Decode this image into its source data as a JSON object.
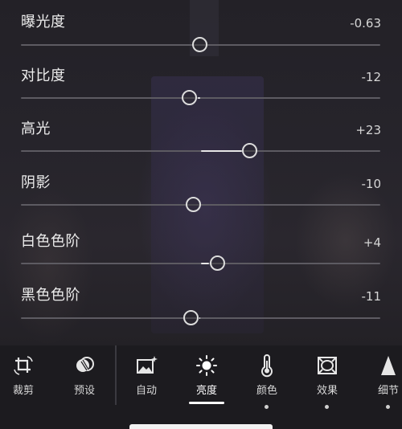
{
  "adjustments": [
    {
      "key": "exposure",
      "label": "曝光度",
      "value": "-0.63",
      "level": -0.06
    },
    {
      "key": "contrast",
      "label": "对比度",
      "value": "-12",
      "level": -0.12
    },
    {
      "key": "highlights",
      "label": "高光",
      "value": "+23",
      "level": 0.23
    },
    {
      "key": "shadows",
      "label": "阴影",
      "value": "-10",
      "level": -0.1
    },
    {
      "key": "whites",
      "label": "白色色阶",
      "value": "+4",
      "level": 0.04
    },
    {
      "key": "blacks",
      "label": "黑色色阶",
      "value": "-11",
      "level": -0.11
    }
  ],
  "toolbar": {
    "tools": [
      {
        "label": "裁剪",
        "icon": "crop-rotate-icon",
        "active": false,
        "dot": false
      },
      {
        "label": "预设",
        "icon": "presets-icon",
        "active": false,
        "dot": false
      },
      {
        "label": "自动",
        "icon": "auto-enhance-icon",
        "active": false,
        "dot": false
      },
      {
        "label": "亮度",
        "icon": "brightness-icon",
        "active": true,
        "dot": false
      },
      {
        "label": "颜色",
        "icon": "thermometer-icon",
        "active": false,
        "dot": true
      },
      {
        "label": "效果",
        "icon": "vignette-effect-icon",
        "active": false,
        "dot": true
      },
      {
        "label": "细节",
        "icon": "detail-triangle-icon",
        "active": false,
        "dot": true
      }
    ]
  },
  "colors": {
    "track": "#5d5b62",
    "fill": "#e6e6e6",
    "knob_border": "#dcdcdc",
    "active_underline": "#ffffff"
  }
}
